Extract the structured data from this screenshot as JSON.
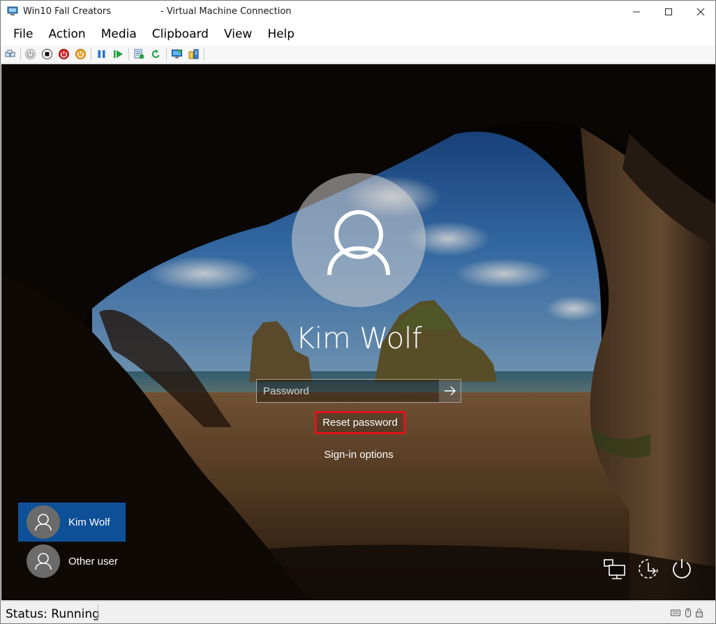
{
  "window": {
    "app_title": "Win10 Fall Creators",
    "subtitle": "- Virtual Machine Connection"
  },
  "menu": {
    "items": [
      "File",
      "Action",
      "Media",
      "Clipboard",
      "View",
      "Help"
    ]
  },
  "toolbar": {
    "icons": [
      "ctrl-alt-del-icon",
      "start-icon",
      "turn-off-icon",
      "shut-down-icon",
      "save-state-icon",
      "pause-icon",
      "resume-icon",
      "checkpoint-icon",
      "revert-icon",
      "enhanced-session-icon",
      "share-icon"
    ]
  },
  "login": {
    "user_name": "Kim Wolf",
    "password_placeholder": "Password",
    "reset_password": "Reset password",
    "signin_options": "Sign-in options",
    "users": [
      {
        "label": "Kim Wolf",
        "selected": true
      },
      {
        "label": "Other user",
        "selected": false
      }
    ],
    "highlight_color": "#e3121b",
    "selected_user_color": "#0e5097"
  },
  "status": {
    "text": "Status: Running"
  }
}
